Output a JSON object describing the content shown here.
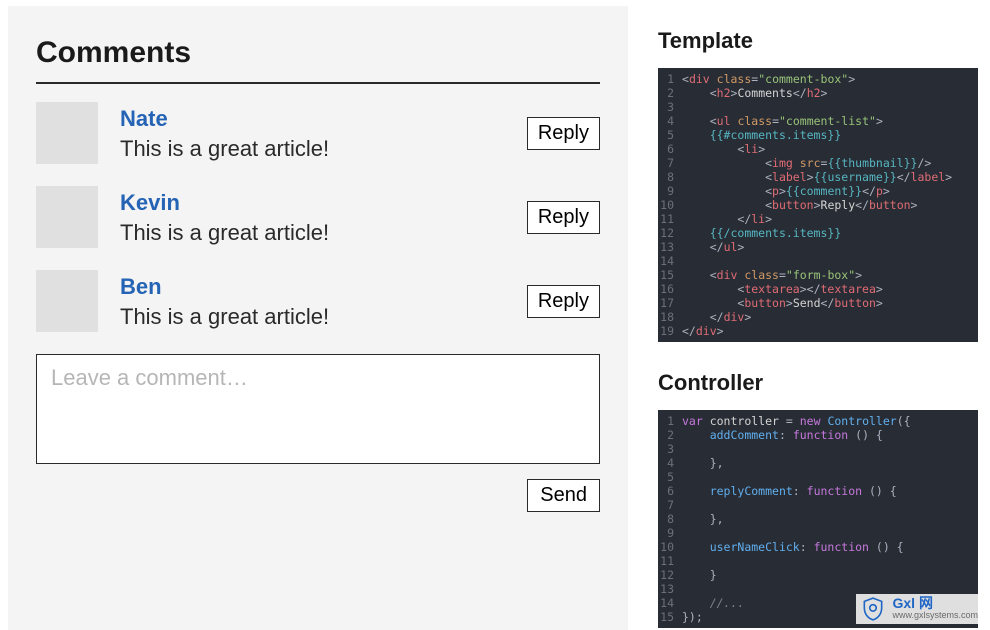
{
  "comments_box": {
    "title": "Comments",
    "reply_label": "Reply",
    "send_label": "Send",
    "placeholder": "Leave a comment…",
    "items": [
      {
        "username": "Nate",
        "comment": "This is a great article!"
      },
      {
        "username": "Kevin",
        "comment": "This is a great article!"
      },
      {
        "username": "Ben",
        "comment": "This is a great article!"
      }
    ]
  },
  "sections": {
    "template_heading": "Template",
    "controller_heading": "Controller"
  },
  "template_code": [
    [
      [
        "tok-punc",
        "<"
      ],
      [
        "tok-tag",
        "div"
      ],
      [
        "tok-txt",
        " "
      ],
      [
        "tok-attr",
        "class"
      ],
      [
        "tok-punc",
        "="
      ],
      [
        "tok-str",
        "\"comment-box\""
      ],
      [
        "tok-punc",
        ">"
      ]
    ],
    [
      [
        "tok-txt",
        "    "
      ],
      [
        "tok-punc",
        "<"
      ],
      [
        "tok-tag",
        "h2"
      ],
      [
        "tok-punc",
        ">"
      ],
      [
        "tok-txt",
        "Comments"
      ],
      [
        "tok-punc",
        "</"
      ],
      [
        "tok-tag",
        "h2"
      ],
      [
        "tok-punc",
        ">"
      ]
    ],
    [],
    [
      [
        "tok-txt",
        "    "
      ],
      [
        "tok-punc",
        "<"
      ],
      [
        "tok-tag",
        "ul"
      ],
      [
        "tok-txt",
        " "
      ],
      [
        "tok-attr",
        "class"
      ],
      [
        "tok-punc",
        "="
      ],
      [
        "tok-str",
        "\"comment-list\""
      ],
      [
        "tok-punc",
        ">"
      ]
    ],
    [
      [
        "tok-txt",
        "    "
      ],
      [
        "tok-mus",
        "{{#comments.items}}"
      ]
    ],
    [
      [
        "tok-txt",
        "        "
      ],
      [
        "tok-punc",
        "<"
      ],
      [
        "tok-tag",
        "li"
      ],
      [
        "tok-punc",
        ">"
      ]
    ],
    [
      [
        "tok-txt",
        "            "
      ],
      [
        "tok-punc",
        "<"
      ],
      [
        "tok-tag",
        "img"
      ],
      [
        "tok-txt",
        " "
      ],
      [
        "tok-attr",
        "src"
      ],
      [
        "tok-punc",
        "="
      ],
      [
        "tok-mus",
        "{{thumbnail}}"
      ],
      [
        "tok-punc",
        "/>"
      ]
    ],
    [
      [
        "tok-txt",
        "            "
      ],
      [
        "tok-punc",
        "<"
      ],
      [
        "tok-tag",
        "label"
      ],
      [
        "tok-punc",
        ">"
      ],
      [
        "tok-mus",
        "{{username}}"
      ],
      [
        "tok-punc",
        "</"
      ],
      [
        "tok-tag",
        "label"
      ],
      [
        "tok-punc",
        ">"
      ]
    ],
    [
      [
        "tok-txt",
        "            "
      ],
      [
        "tok-punc",
        "<"
      ],
      [
        "tok-tag",
        "p"
      ],
      [
        "tok-punc",
        ">"
      ],
      [
        "tok-mus",
        "{{comment}}"
      ],
      [
        "tok-punc",
        "</"
      ],
      [
        "tok-tag",
        "p"
      ],
      [
        "tok-punc",
        ">"
      ]
    ],
    [
      [
        "tok-txt",
        "            "
      ],
      [
        "tok-punc",
        "<"
      ],
      [
        "tok-tag",
        "button"
      ],
      [
        "tok-punc",
        ">"
      ],
      [
        "tok-txt",
        "Reply"
      ],
      [
        "tok-punc",
        "</"
      ],
      [
        "tok-tag",
        "button"
      ],
      [
        "tok-punc",
        ">"
      ]
    ],
    [
      [
        "tok-txt",
        "        "
      ],
      [
        "tok-punc",
        "</"
      ],
      [
        "tok-tag",
        "li"
      ],
      [
        "tok-punc",
        ">"
      ]
    ],
    [
      [
        "tok-txt",
        "    "
      ],
      [
        "tok-mus",
        "{{/comments.items}}"
      ]
    ],
    [
      [
        "tok-txt",
        "    "
      ],
      [
        "tok-punc",
        "</"
      ],
      [
        "tok-tag",
        "ul"
      ],
      [
        "tok-punc",
        ">"
      ]
    ],
    [],
    [
      [
        "tok-txt",
        "    "
      ],
      [
        "tok-punc",
        "<"
      ],
      [
        "tok-tag",
        "div"
      ],
      [
        "tok-txt",
        " "
      ],
      [
        "tok-attr",
        "class"
      ],
      [
        "tok-punc",
        "="
      ],
      [
        "tok-str",
        "\"form-box\""
      ],
      [
        "tok-punc",
        ">"
      ]
    ],
    [
      [
        "tok-txt",
        "        "
      ],
      [
        "tok-punc",
        "<"
      ],
      [
        "tok-tag",
        "textarea"
      ],
      [
        "tok-punc",
        "></"
      ],
      [
        "tok-tag",
        "textarea"
      ],
      [
        "tok-punc",
        ">"
      ]
    ],
    [
      [
        "tok-txt",
        "        "
      ],
      [
        "tok-punc",
        "<"
      ],
      [
        "tok-tag",
        "button"
      ],
      [
        "tok-punc",
        ">"
      ],
      [
        "tok-txt",
        "Send"
      ],
      [
        "tok-punc",
        "</"
      ],
      [
        "tok-tag",
        "button"
      ],
      [
        "tok-punc",
        ">"
      ]
    ],
    [
      [
        "tok-txt",
        "    "
      ],
      [
        "tok-punc",
        "</"
      ],
      [
        "tok-tag",
        "div"
      ],
      [
        "tok-punc",
        ">"
      ]
    ],
    [
      [
        "tok-punc",
        "</"
      ],
      [
        "tok-tag",
        "div"
      ],
      [
        "tok-punc",
        ">"
      ]
    ]
  ],
  "controller_code": [
    [
      [
        "tok-key",
        "var"
      ],
      [
        "tok-txt",
        " controller "
      ],
      [
        "tok-punc",
        "= "
      ],
      [
        "tok-key",
        "new"
      ],
      [
        "tok-txt",
        " "
      ],
      [
        "tok-fn",
        "Controller"
      ],
      [
        "tok-punc",
        "({"
      ]
    ],
    [
      [
        "tok-txt",
        "    "
      ],
      [
        "tok-fn",
        "addComment"
      ],
      [
        "tok-punc",
        ": "
      ],
      [
        "tok-key",
        "function"
      ],
      [
        "tok-txt",
        " "
      ],
      [
        "tok-punc",
        "() {"
      ]
    ],
    [],
    [
      [
        "tok-txt",
        "    "
      ],
      [
        "tok-punc",
        "},"
      ]
    ],
    [],
    [
      [
        "tok-txt",
        "    "
      ],
      [
        "tok-fn",
        "replyComment"
      ],
      [
        "tok-punc",
        ": "
      ],
      [
        "tok-key",
        "function"
      ],
      [
        "tok-txt",
        " "
      ],
      [
        "tok-punc",
        "() {"
      ]
    ],
    [],
    [
      [
        "tok-txt",
        "    "
      ],
      [
        "tok-punc",
        "},"
      ]
    ],
    [],
    [
      [
        "tok-txt",
        "    "
      ],
      [
        "tok-fn",
        "userNameClick"
      ],
      [
        "tok-punc",
        ": "
      ],
      [
        "tok-key",
        "function"
      ],
      [
        "tok-txt",
        " "
      ],
      [
        "tok-punc",
        "() {"
      ]
    ],
    [],
    [
      [
        "tok-txt",
        "    "
      ],
      [
        "tok-punc",
        "}"
      ]
    ],
    [],
    [
      [
        "tok-txt",
        "    "
      ],
      [
        "tok-comm",
        "//..."
      ]
    ],
    [
      [
        "tok-punc",
        "});"
      ]
    ]
  ],
  "watermark": {
    "brand": "Gxl 网",
    "sub": "www.gxlsystems.com"
  }
}
